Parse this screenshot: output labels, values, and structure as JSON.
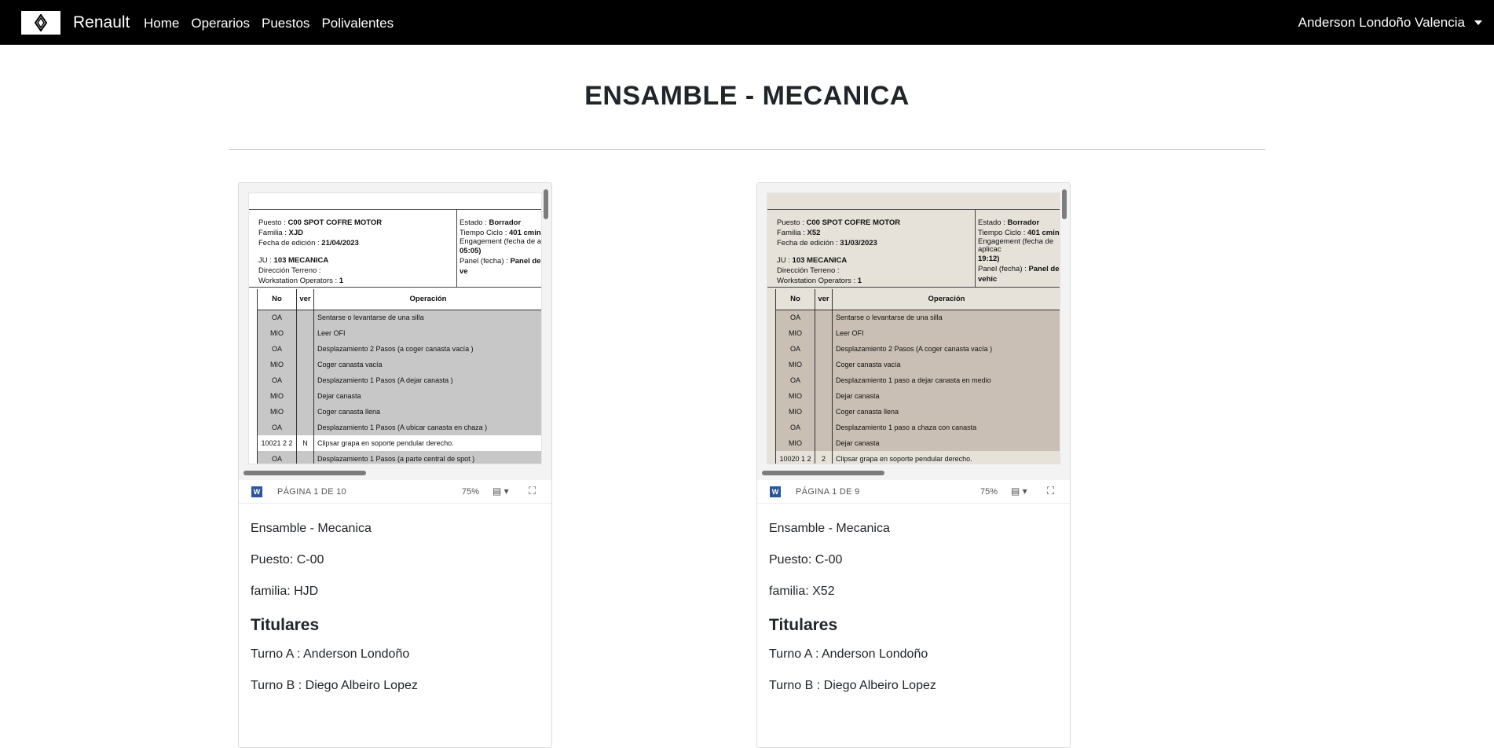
{
  "nav": {
    "brand": "Renault",
    "links": [
      "Home",
      "Operarios",
      "Puestos",
      "Polivalentes"
    ],
    "user": "Anderson Londoño Valencia"
  },
  "page": {
    "title": "ENSAMBLE - MECANICA"
  },
  "cards": [
    {
      "doc": {
        "puesto_label": "Puesto :",
        "puesto_value": "C00 SPOT COFRE MOTOR",
        "familia_label": "Familia :",
        "familia_value": "XJD",
        "fecha_label": "Fecha de edición :",
        "fecha_value": "21/04/2023",
        "ju_label": "JU :",
        "ju_value": "103 MECANICA",
        "direccion": "Dirección Terreno :",
        "workstation_label": "Workstation Operators :",
        "workstation_value": "1",
        "estado_label": "Estado :",
        "estado_value": "Borrador",
        "tiempo_label": "Tiempo Ciclo :",
        "tiempo_value": "401 cmin",
        "engagement": "Engagement (fecha de apl",
        "engagement_time": "05:05)",
        "panel_label": "Panel (fecha) :",
        "panel_value": "Panel de ve",
        "headers": [
          "No",
          "ver",
          "Operación"
        ],
        "rows": [
          {
            "no": "OA",
            "ver": "",
            "op": "Sentarse o levantarse de una silla",
            "shade": true
          },
          {
            "no": "MIO",
            "ver": "",
            "op": "Leer OFI",
            "shade": true
          },
          {
            "no": "OA",
            "ver": "",
            "op": "Desplazamiento 2 Pasos (a coger canasta vacía )",
            "shade": true
          },
          {
            "no": "MIO",
            "ver": "",
            "op": "Coger canasta vacía",
            "shade": true
          },
          {
            "no": "OA",
            "ver": "",
            "op": "Desplazamiento 1 Pasos (A dejar canasta )",
            "shade": true
          },
          {
            "no": "MIO",
            "ver": "",
            "op": "Dejar canasta",
            "shade": true
          },
          {
            "no": "MIO",
            "ver": "",
            "op": "Coger canasta llena",
            "shade": true
          },
          {
            "no": "OA",
            "ver": "",
            "op": "Desplazamiento 1 Pasos (A ubicar canasta en chaza )",
            "shade": true
          },
          {
            "no": "10021 2 2",
            "ver": "N",
            "op": "Clipsar grapa en soporte pendular derecho.",
            "shade": false
          },
          {
            "no": "OA",
            "ver": "",
            "op": "Desplazamiento 1 Pasos (a parte central de spot )",
            "shade": true
          }
        ]
      },
      "toolbar": {
        "page_info": "PÁGINA 1 DE 10",
        "zoom": "75%"
      },
      "area": "Ensamble - Mecanica",
      "puesto": "Puesto: C-00",
      "familia": "familia: HJD",
      "titulares": "Titulares",
      "turno_a": "Turno A : Anderson Londoño",
      "turno_b": "Turno B : Diego Albeiro Lopez"
    },
    {
      "doc": {
        "puesto_label": "Puesto :",
        "puesto_value": "C00 SPOT COFRE MOTOR",
        "familia_label": "Familia :",
        "familia_value": "X52",
        "fecha_label": "Fecha de edición :",
        "fecha_value": "31/03/2023",
        "ju_label": "JU :",
        "ju_value": "103 MECANICA",
        "direccion": "Dirección Terreno :",
        "workstation_label": "Workstation Operators :",
        "workstation_value": "1",
        "estado_label": "Estado :",
        "estado_value": "Borrador",
        "tiempo_label": "Tiempo Ciclo :",
        "tiempo_value": "401 cmin",
        "engagement": "Engagement (fecha de aplicac",
        "engagement_time": "19:12)",
        "panel_label": "Panel (fecha) :",
        "panel_value": "Panel de vehic",
        "headers": [
          "No",
          "ver",
          "Operación"
        ],
        "rows": [
          {
            "no": "OA",
            "ver": "",
            "op": "Sentarse o levantarse de una silla",
            "shade": true
          },
          {
            "no": "MIO",
            "ver": "",
            "op": "Leer OFI",
            "shade": true
          },
          {
            "no": "OA",
            "ver": "",
            "op": "Desplazamiento 2 Pasos (A coger canasta vacía )",
            "shade": true
          },
          {
            "no": "MIO",
            "ver": "",
            "op": "Coger canasta vacía",
            "shade": true
          },
          {
            "no": "OA",
            "ver": "",
            "op": "Desplazamiento 1 paso a dejar canasta en medio",
            "shade": true
          },
          {
            "no": "MIO",
            "ver": "",
            "op": "Dejar canasta",
            "shade": true
          },
          {
            "no": "MIO",
            "ver": "",
            "op": "Coger canasta llena",
            "shade": true
          },
          {
            "no": "OA",
            "ver": "",
            "op": "Desplazamiento 1 paso a chaza con canasta",
            "shade": true
          },
          {
            "no": "MIO",
            "ver": "",
            "op": "Dejar canasta",
            "shade": true
          },
          {
            "no": "10020 1 2",
            "ver": "2",
            "op": "Clipsar grapa en soporte pendular derecho.",
            "shade": false
          }
        ]
      },
      "toolbar": {
        "page_info": "PÁGINA 1 DE 9",
        "zoom": "75%"
      },
      "area": "Ensamble - Mecanica",
      "puesto": "Puesto: C-00",
      "familia": "familia: X52",
      "titulares": "Titulares",
      "turno_a": "Turno A : Anderson Londoño",
      "turno_b": "Turno B : Diego Albeiro Lopez"
    }
  ],
  "icons": {
    "word": "word-icon",
    "layout": "page-layout-icon",
    "fullscreen": "fullscreen-icon",
    "logo": "renault-logo-icon"
  },
  "colors": {
    "navbar": "#000000",
    "word": "#2b579a"
  }
}
